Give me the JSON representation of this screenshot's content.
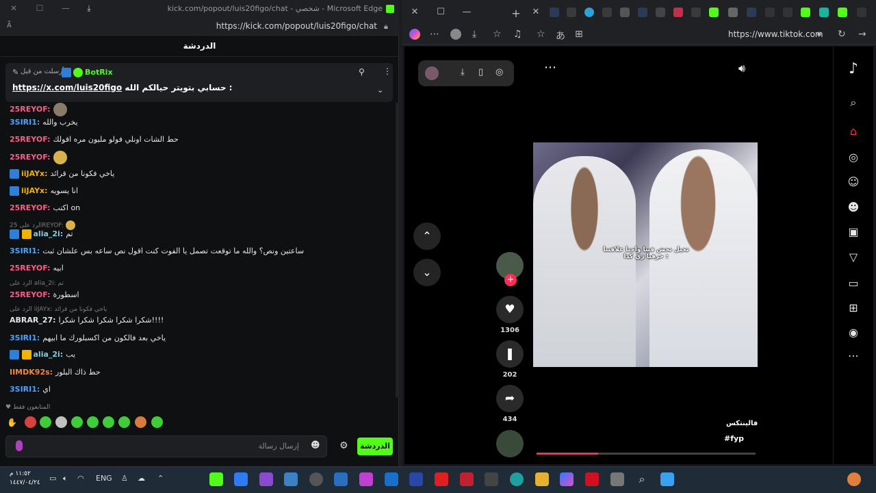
{
  "left_window": {
    "title": "kick.com/popout/luis20figo/chat - شخصي - Microsoft Edge",
    "url": "https://kick.com/popout/luis20figo/chat",
    "chat_header": "الدردشة",
    "pinned": {
      "by_label": "أرسلت من قبل",
      "user": "BotRix",
      "message_text": "حسابي بتويتر حيالكم الله :",
      "link": "https://x.com/luis20figo"
    },
    "messages": [
      {
        "user": "25REYOF:",
        "text": "",
        "color": "#ff5c8a"
      },
      {
        "user": "3SIRI1:",
        "text": "يخرب والله",
        "color": "#4aa3ff"
      },
      {
        "user": "25REYOF:",
        "text": "حط الشات اونلي فولو مليون مره اقولك",
        "color": "#ff5c8a"
      },
      {
        "user": "25REYOF:",
        "text": "",
        "color": "#ff5c8a"
      },
      {
        "user": "iiJAYx:",
        "text": "ياخي فكونا من قرائد",
        "color": "#f0b400"
      },
      {
        "user": "iiJAYx:",
        "text": "انا يسويه",
        "color": "#f0b400"
      },
      {
        "user": "25REYOF:",
        "text": "اكتب on",
        "color": "#ff5c8a"
      },
      {
        "reply": "الرد على 25REYOF:"
      },
      {
        "user": "alia_2i:",
        "text": "تم",
        "color": "#7ed0e0"
      },
      {
        "user": "3SIRI1:",
        "text": "ساعتين ونص؟ والله ما توقعت تصمل يا الفوت كنت اقول نص ساعه بس علشان ثبت",
        "color": "#4aa3ff"
      },
      {
        "user": "25REYOF:",
        "text": "ابيه",
        "color": "#ff5c8a"
      },
      {
        "reply": "الرد على alia_2i: تم"
      },
      {
        "user": "25REYOF:",
        "text": "اسطورة",
        "color": "#ff5c8a"
      },
      {
        "reply": "الرد على iiJAYx: ياخي فكونا من قرائد"
      },
      {
        "user": "ABRAR_27:",
        "text": "شكرا شكرا شكرا شكرا شكرا!!!!",
        "color": "#e6e6e6"
      },
      {
        "user": "3SIRI1:",
        "text": "ياخي بعد فالكون من اكسبلورك ما ابيهم",
        "color": "#4aa3ff"
      },
      {
        "user": "alia_2i:",
        "text": "يب",
        "color": "#7ed0e0"
      },
      {
        "user": "IIMDK92s:",
        "text": "حط ذاك البلور",
        "color": "#f08a3c"
      },
      {
        "user": "3SIRI1:",
        "text": "اي",
        "color": "#4aa3ff"
      }
    ],
    "followers_only": "المتابعون فقط",
    "input_placeholder": "إرسال رسالة",
    "send_label": "الدردشة"
  },
  "right_window": {
    "url": "https://www.tiktok.com",
    "video_caption": "تخيل تحش فينا واحنا علاقتنا حرفيا زي كذا :",
    "actions": {
      "likes": "1306",
      "saves": "202",
      "shares": "434"
    },
    "author_line": "فالينتكس",
    "hashtag": "#fyp"
  },
  "taskbar": {
    "time": "١١:٥٢ م",
    "date": "١٤٤٧/٠٤/٢٤",
    "lang": "ENG"
  }
}
